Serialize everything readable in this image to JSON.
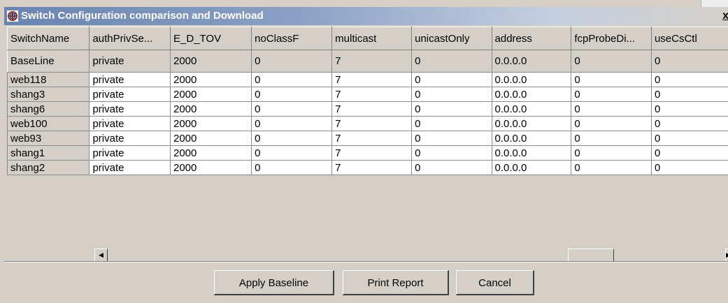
{
  "window": {
    "title": "Switch Configuration comparison and Download",
    "close_label": "x"
  },
  "table": {
    "columns": [
      "SwitchName",
      "authPrivSe...",
      "E_D_TOV",
      "noClassF",
      "multicast",
      "unicastOnly",
      "address",
      "fcpProbeDi...",
      "useCsCtl"
    ],
    "rows": [
      [
        "BaseLine",
        "private",
        "2000",
        "0",
        "7",
        "0",
        "0.0.0.0",
        "0",
        "0"
      ],
      [
        "web118",
        "private",
        "2000",
        "0",
        "7",
        "0",
        "0.0.0.0",
        "0",
        "0"
      ],
      [
        "shang3",
        "private",
        "2000",
        "0",
        "7",
        "0",
        "0.0.0.0",
        "0",
        "0"
      ],
      [
        "shang6",
        "private",
        "2000",
        "0",
        "7",
        "0",
        "0.0.0.0",
        "0",
        "0"
      ],
      [
        "web100",
        "private",
        "2000",
        "0",
        "7",
        "0",
        "0.0.0.0",
        "0",
        "0"
      ],
      [
        "web93",
        "private",
        "2000",
        "0",
        "7",
        "0",
        "0.0.0.0",
        "0",
        "0"
      ],
      [
        "shang1",
        "private",
        "2000",
        "0",
        "7",
        "0",
        "0.0.0.0",
        "0",
        "0"
      ],
      [
        "shang2",
        "private",
        "2000",
        "0",
        "7",
        "0",
        "0.0.0.0",
        "0",
        "0"
      ]
    ]
  },
  "scrollbar": {
    "left_arrow": "◀",
    "right_arrow": "▶"
  },
  "buttons": {
    "apply_baseline": "Apply Baseline",
    "print_report": "Print Report",
    "cancel": "Cancel"
  },
  "icons": {
    "app": "network-switch-icon",
    "close": "close-icon"
  }
}
